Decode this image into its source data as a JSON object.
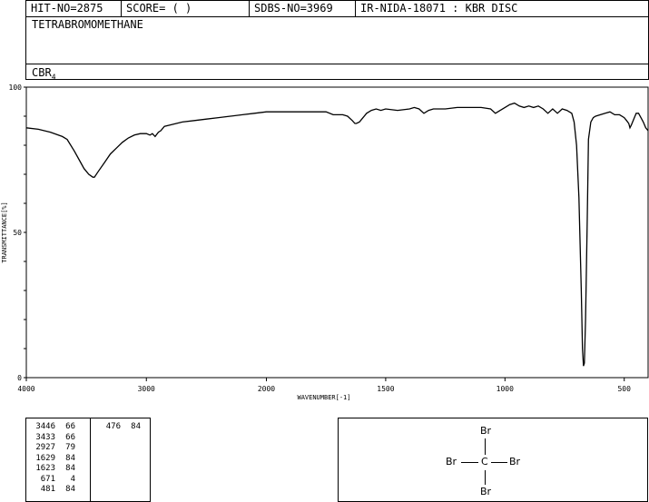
{
  "header": {
    "hit_no": "HIT-NO=2875",
    "score": "SCORE=  (   )",
    "sdbs_no": "SDBS-NO=3969",
    "ir_code": "IR-NIDA-18071 : KBR DISC",
    "compound_name": "TETRABROMOMETHANE",
    "formula_main": "CBR",
    "formula_sub": "4"
  },
  "chart_data": {
    "type": "line",
    "xlabel": "WAVENUMBER[-1]",
    "ylabel": "TRANSMITTANCE[%]",
    "xlim": [
      4000,
      400
    ],
    "ylim": [
      0,
      100
    ],
    "x_ticks": [
      "4000",
      "3000",
      "2000",
      "1500",
      "1000",
      "500"
    ],
    "y_ticks": [
      "100",
      "50",
      "0"
    ],
    "series": [
      {
        "x": [
          4000,
          3900,
          3800,
          3700,
          3660,
          3600,
          3560,
          3520,
          3480,
          3446,
          3433,
          3400,
          3350,
          3300,
          3250,
          3200,
          3150,
          3100,
          3050,
          3000,
          2970,
          2950,
          2927,
          2900,
          2880,
          2850,
          2800,
          2700,
          2600,
          2500,
          2400,
          2300,
          2200,
          2100,
          2000,
          1900,
          1800,
          1750,
          1720,
          1700,
          1680,
          1660,
          1640,
          1629,
          1623,
          1610,
          1600,
          1580,
          1560,
          1540,
          1520,
          1500,
          1450,
          1400,
          1380,
          1360,
          1340,
          1320,
          1300,
          1250,
          1200,
          1150,
          1100,
          1060,
          1040,
          1020,
          1000,
          980,
          960,
          940,
          920,
          900,
          880,
          860,
          840,
          820,
          800,
          780,
          760,
          740,
          720,
          710,
          700,
          690,
          680,
          675,
          671,
          667,
          662,
          655,
          650,
          640,
          630,
          620,
          600,
          580,
          560,
          540,
          520,
          500,
          490,
          481,
          476,
          470,
          460,
          450,
          440,
          430,
          420,
          410,
          400
        ],
        "y": [
          86,
          85.5,
          84.5,
          83,
          82,
          78,
          75,
          72,
          70,
          69,
          69,
          71,
          74,
          77,
          79,
          81,
          82.5,
          83.5,
          84,
          84,
          83.5,
          84,
          83,
          84.5,
          85,
          86.5,
          87,
          88,
          88.5,
          89,
          89.5,
          90,
          90.5,
          91,
          91.5,
          91.5,
          91.5,
          91.5,
          90.5,
          90.5,
          90.5,
          90,
          88.5,
          87.5,
          87.5,
          88,
          89,
          91,
          92,
          92.5,
          92,
          92.5,
          92,
          92.5,
          93,
          92.5,
          91,
          92,
          92.5,
          92.5,
          93,
          93,
          93,
          92.5,
          91,
          92,
          93,
          94,
          94.5,
          93.5,
          93,
          93.5,
          93,
          93.5,
          92.5,
          91,
          92.5,
          91,
          92.5,
          92,
          91,
          88,
          80,
          62,
          30,
          10,
          4,
          5,
          20,
          55,
          82,
          88,
          89.5,
          90,
          90.5,
          91,
          91.5,
          90.5,
          90.5,
          89.5,
          88.5,
          87.5,
          86,
          87,
          89,
          91,
          91,
          89.5,
          88,
          86,
          85
        ]
      }
    ]
  },
  "peak_table": [
    [
      "3446",
      "66"
    ],
    [
      "3433",
      "66"
    ],
    [
      "2927",
      "79"
    ],
    [
      "1629",
      "84"
    ],
    [
      "1623",
      "84"
    ],
    [
      "671",
      "4"
    ],
    [
      "481",
      "84"
    ],
    [
      "476",
      "84"
    ]
  ],
  "structure": {
    "center": "C",
    "top": "Br",
    "left": "Br",
    "right": "Br",
    "bottom": "Br"
  }
}
